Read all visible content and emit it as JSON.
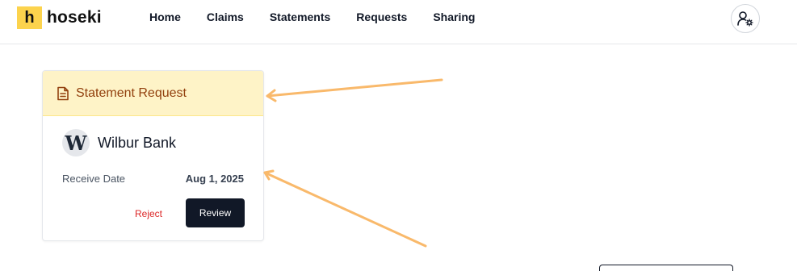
{
  "brand": {
    "mark": "h",
    "name": "hoseki"
  },
  "nav": [
    {
      "label": "Home"
    },
    {
      "label": "Claims"
    },
    {
      "label": "Statements"
    },
    {
      "label": "Requests"
    },
    {
      "label": "Sharing"
    }
  ],
  "user_menu": {
    "icon": "user-settings-icon"
  },
  "card": {
    "header": {
      "icon": "document-icon",
      "title": "Statement Request"
    },
    "bank": {
      "logo_letter": "W",
      "name": "Wilbur Bank"
    },
    "meta": {
      "label": "Receive Date",
      "value": "Aug 1, 2025"
    },
    "actions": {
      "reject": "Reject",
      "review": "Review"
    }
  },
  "colors": {
    "brand_yellow": "#fcd34d",
    "header_bg": "#fef3c7",
    "header_text": "#92400e",
    "reject_red": "#dc2626",
    "primary_dark": "#111827",
    "annotation_arrow": "#f9b96b"
  }
}
